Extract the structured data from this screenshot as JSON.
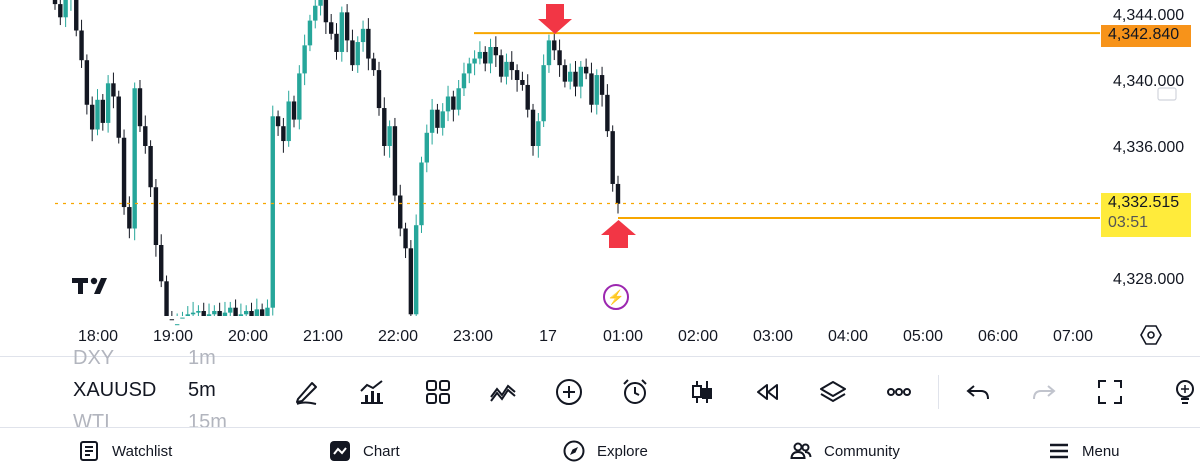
{
  "chart": {
    "symbol": "XAUUSD",
    "timeframe": "5m",
    "price_axis": [
      "4,344.000",
      "4,340.000",
      "4,336.000",
      "4,328.000"
    ],
    "time_axis": [
      "18:00",
      "19:00",
      "20:00",
      "21:00",
      "22:00",
      "23:00",
      "17",
      "01:00",
      "02:00",
      "03:00",
      "04:00",
      "05:00",
      "06:00",
      "07:00"
    ],
    "alert_price": "4,342.840",
    "current_price": "4,332.515",
    "countdown": "03:51",
    "colors": {
      "up": "#26a69a",
      "down": "#131722",
      "alert_line": "#f7a600",
      "price_line": "#f7a600",
      "arrow": "#f23645",
      "tag_alert": "#f7931a",
      "tag_current": "#ffeb3b"
    }
  },
  "chart_data": {
    "type": "candlestick",
    "ylim": [
      4325.0,
      4345.0
    ],
    "annotations": {
      "horizontal_line_price": 4342.84,
      "current_price": 4332.515,
      "arrow_down_at": "23:55",
      "arrow_up_at": "00:50"
    }
  },
  "watchlist_switcher": {
    "prev_symbol": "DXY",
    "prev_timeframe": "1m",
    "next_symbol": "WTI",
    "next_timeframe": "15m"
  },
  "toolbar": {
    "icons": [
      "pencil-icon",
      "indicators-icon",
      "layout-icon",
      "patterns-icon",
      "add-icon",
      "alarm-icon",
      "candles-icon",
      "replay-icon",
      "layers-icon",
      "more-icon",
      "undo-icon",
      "redo-icon",
      "fullscreen-icon",
      "idea-icon"
    ]
  },
  "nav": {
    "watchlist": "Watchlist",
    "chart": "Chart",
    "explore": "Explore",
    "community": "Community",
    "menu": "Menu"
  }
}
